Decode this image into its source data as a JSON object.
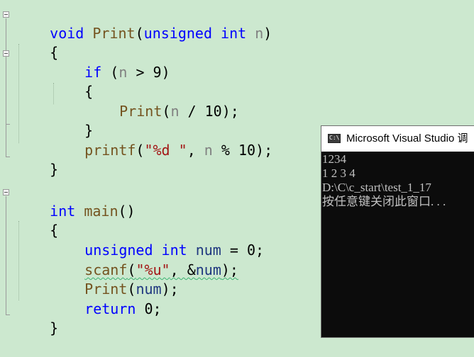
{
  "editor": {
    "lines": [
      {
        "t1": "void",
        "t2": " ",
        "t3": "Print",
        "t4": "(",
        "t5": "unsigned",
        "t6": " ",
        "t7": "int",
        "t8": " ",
        "t9": "n",
        "t10": ")"
      },
      {
        "t1": "{"
      },
      {
        "t1": "if",
        "t2": " (",
        "t3": "n",
        "t4": " > 9)"
      },
      {
        "t1": "{"
      },
      {
        "t1": "Print",
        "t2": "(",
        "t3": "n",
        "t4": " / 10);"
      },
      {
        "t1": "}"
      },
      {
        "t1": "printf",
        "t2": "(",
        "t3": "\"%d \"",
        "t4": ", ",
        "t5": "n",
        "t6": " % 10);"
      },
      {
        "t1": "}"
      },
      {
        "t1": "int",
        "t2": " ",
        "t3": "main",
        "t4": "()"
      },
      {
        "t1": "{"
      },
      {
        "t1": "unsigned",
        "t2": " ",
        "t3": "int",
        "t4": " ",
        "t5": "num",
        "t6": " = 0;"
      },
      {
        "t1": "scanf",
        "t2": "(",
        "t3": "\"%u\"",
        "t4": ", &",
        "t5": "num",
        "t6": ");"
      },
      {
        "t1": "Print",
        "t2": "(",
        "t3": "num",
        "t4": ");"
      },
      {
        "t1": "return",
        "t2": " 0;"
      },
      {
        "t1": "}"
      }
    ]
  },
  "console": {
    "title": "Microsoft Visual Studio 调",
    "app_icon": "C:\\",
    "output": [
      "1234",
      "1 2 3 4",
      "D:\\C\\c_start\\test_1_17",
      "按任意键关闭此窗口. . ."
    ]
  },
  "colors": {
    "background": "#cce8cf",
    "keyword": "#0000ff",
    "function": "#74531f",
    "parameter": "#808080",
    "local_variable": "#1f377f",
    "string": "#a31515",
    "console_bg": "#0c0c0c",
    "console_text": "#c0c0c0"
  }
}
